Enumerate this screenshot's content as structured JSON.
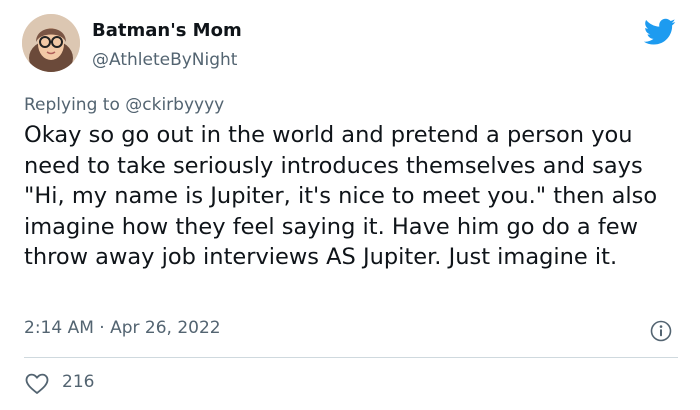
{
  "author": {
    "display_name": "Batman's Mom",
    "handle": "@AthleteByNight"
  },
  "reply": {
    "prefix": "Replying to ",
    "target": "@ckirbyyyy"
  },
  "tweet": {
    "text": "Okay so go out in the world and pretend a person you need to take seriously introduces themselves and says \"Hi, my name is Jupiter, it's nice to meet you.\" then also imagine how they feel saying it. Have him go do a few throw away job interviews AS Jupiter. Just imagine it.",
    "timestamp": "2:14 AM · Apr 26, 2022"
  },
  "engagement": {
    "likes": "216"
  },
  "icons": {
    "brand": "twitter-bird-icon",
    "info": "info-icon",
    "like": "heart-icon"
  },
  "colors": {
    "twitter_blue": "#1d9bf0",
    "secondary_text": "#536471",
    "primary_text": "#0f1419"
  }
}
